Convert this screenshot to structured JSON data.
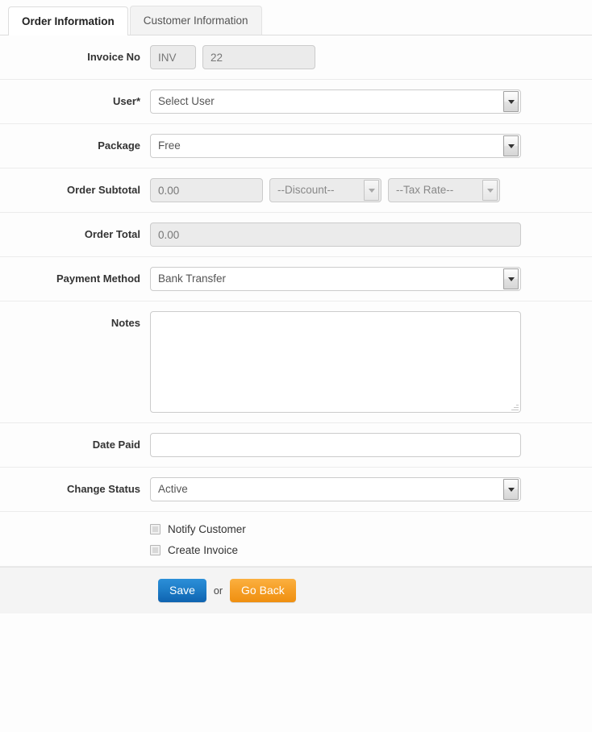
{
  "tabs": [
    {
      "label": "Order Information",
      "active": true
    },
    {
      "label": "Customer Information",
      "active": false
    }
  ],
  "form": {
    "invoice_no": {
      "label": "Invoice No",
      "prefix_value": "INV",
      "number_value": "22"
    },
    "user": {
      "label": "User*",
      "selected": "Select User"
    },
    "package": {
      "label": "Package",
      "selected": "Free"
    },
    "order_subtotal": {
      "label": "Order Subtotal",
      "amount_value": "0.00",
      "discount_selected": "--Discount--",
      "tax_selected": "--Tax Rate--"
    },
    "order_total": {
      "label": "Order Total",
      "value": "0.00"
    },
    "payment_method": {
      "label": "Payment Method",
      "selected": "Bank Transfer"
    },
    "notes": {
      "label": "Notes",
      "value": ""
    },
    "date_paid": {
      "label": "Date Paid",
      "value": ""
    },
    "change_status": {
      "label": "Change Status",
      "selected": "Active"
    },
    "checkboxes": [
      {
        "label": "Notify Customer",
        "checked": false
      },
      {
        "label": "Create Invoice",
        "checked": false
      }
    ]
  },
  "footer": {
    "save_label": "Save",
    "or_label": "or",
    "goback_label": "Go Back"
  },
  "colors": {
    "save_button": "#1f7ec8",
    "goback_button": "#f6a028",
    "row_divider": "#ececec",
    "footer_bg": "#f4f4f4"
  }
}
